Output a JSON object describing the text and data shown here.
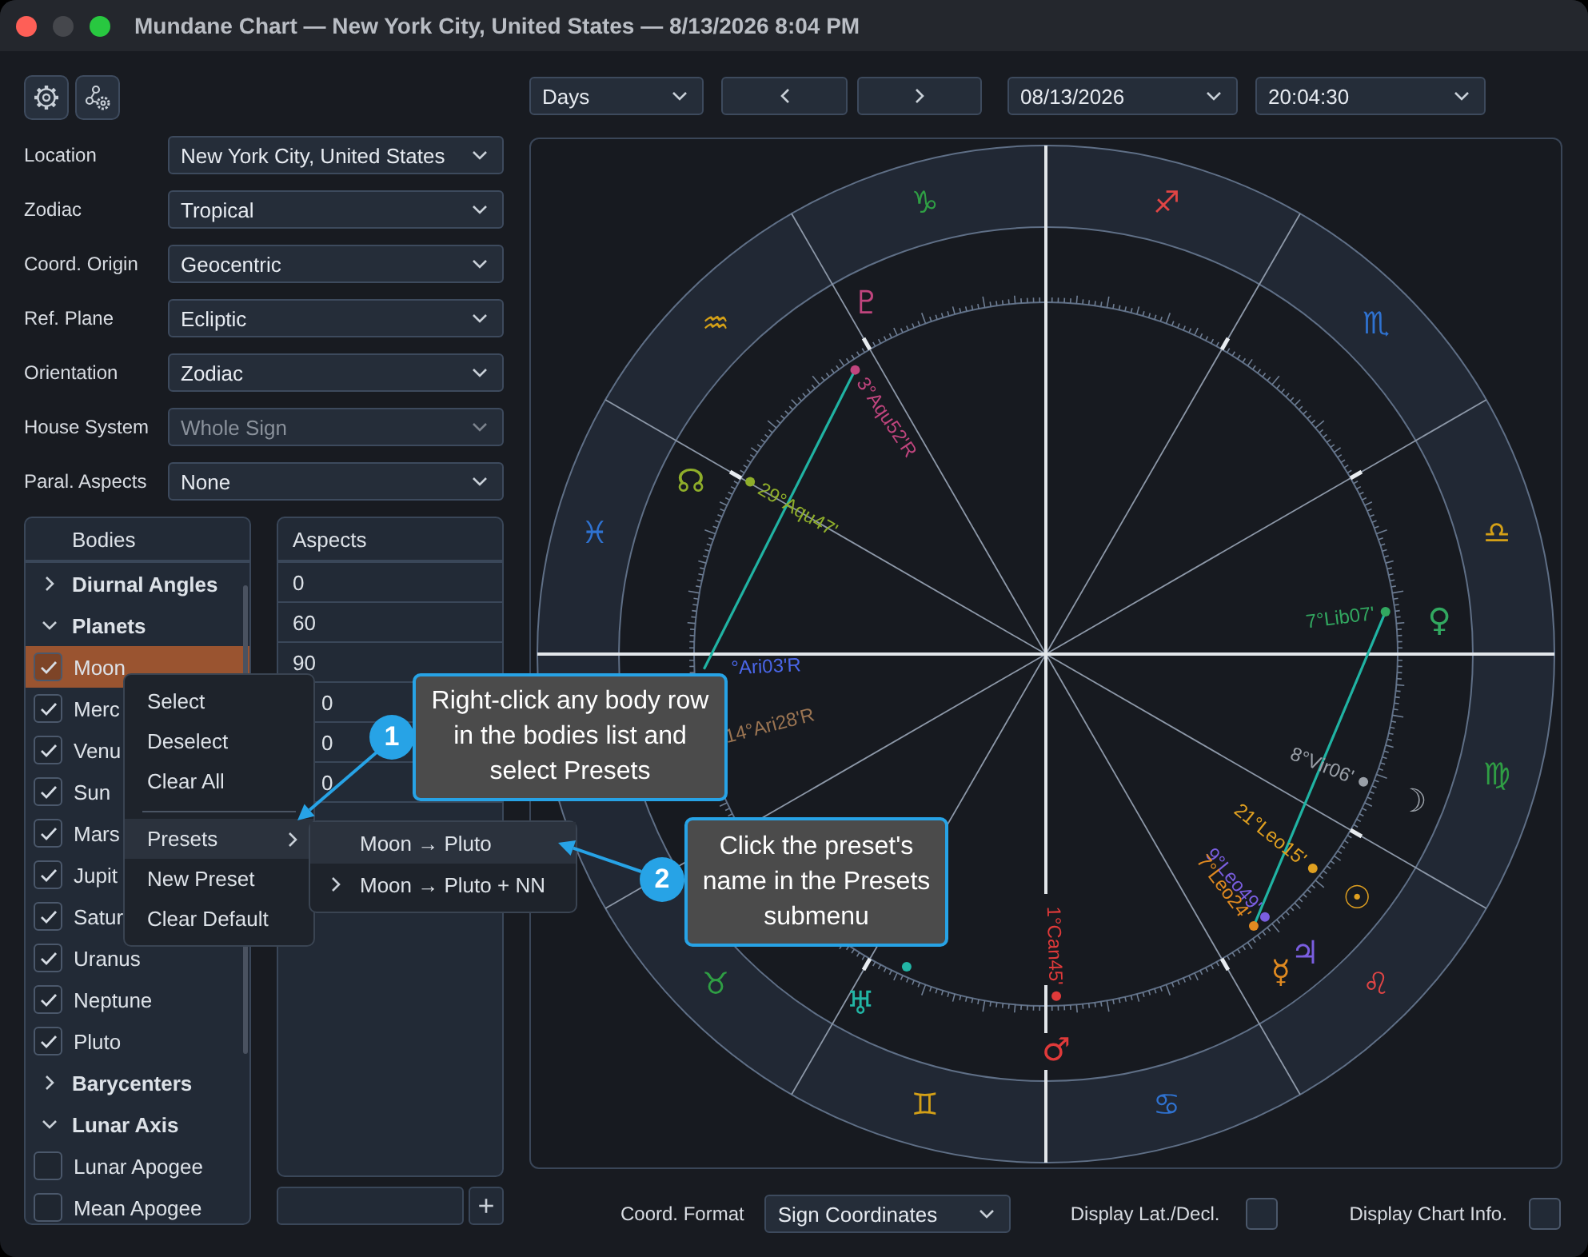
{
  "window": {
    "title": "Mundane Chart — New York City, United States — 8/13/2026 8:04 PM"
  },
  "settings": [
    {
      "label": "Location",
      "value": "New York City, United States",
      "disabled": false
    },
    {
      "label": "Zodiac",
      "value": "Tropical",
      "disabled": false
    },
    {
      "label": "Coord. Origin",
      "value": "Geocentric",
      "disabled": false
    },
    {
      "label": "Ref. Plane",
      "value": "Ecliptic",
      "disabled": false
    },
    {
      "label": "Orientation",
      "value": "Zodiac",
      "disabled": false
    },
    {
      "label": "House System",
      "value": "Whole Sign",
      "disabled": true
    },
    {
      "label": "Paral. Aspects",
      "value": "None",
      "disabled": false
    }
  ],
  "bodies": {
    "title": "Bodies",
    "items": [
      {
        "kind": "group",
        "label": "Diurnal Angles",
        "expanded": false
      },
      {
        "kind": "group",
        "label": "Planets",
        "expanded": true,
        "children": [
          {
            "kind": "body",
            "label": "Moon",
            "checked": true,
            "selected": true
          },
          {
            "kind": "body",
            "label": "Merc",
            "checked": true,
            "selected": false
          },
          {
            "kind": "body",
            "label": "Venu",
            "checked": true,
            "selected": false
          },
          {
            "kind": "body",
            "label": "Sun",
            "checked": true,
            "selected": false
          },
          {
            "kind": "body",
            "label": "Mars",
            "checked": true,
            "selected": false
          },
          {
            "kind": "body",
            "label": "Jupit",
            "checked": true,
            "selected": false
          },
          {
            "kind": "body",
            "label": "Satur",
            "checked": true,
            "selected": false
          },
          {
            "kind": "body",
            "label": "Uranus",
            "checked": true,
            "selected": false
          },
          {
            "kind": "body",
            "label": "Neptune",
            "checked": true,
            "selected": false
          },
          {
            "kind": "body",
            "label": "Pluto",
            "checked": true,
            "selected": false
          }
        ]
      },
      {
        "kind": "group",
        "label": "Barycenters",
        "expanded": false
      },
      {
        "kind": "group",
        "label": "Lunar Axis",
        "expanded": true,
        "children": [
          {
            "kind": "body",
            "label": "Lunar Apogee",
            "checked": false,
            "selected": false
          },
          {
            "kind": "body",
            "label": "Mean Apogee",
            "checked": false,
            "selected": false
          }
        ]
      }
    ]
  },
  "aspects": {
    "title": "Aspects",
    "rows": [
      {
        "value": "0"
      },
      {
        "value": "60"
      },
      {
        "value": "90"
      },
      {
        "value": "0",
        "clipped": true
      },
      {
        "value": "0",
        "clipped": true
      },
      {
        "value": "0",
        "clipped": true
      }
    ],
    "add_button": "+"
  },
  "toolbar": {
    "period": "Days",
    "date": "08/13/2026",
    "time": "20:04:30"
  },
  "chart": {
    "signs": [
      {
        "glyph": "♉",
        "color": "#2f9e44"
      },
      {
        "glyph": "♊",
        "color": "#d4a017"
      },
      {
        "glyph": "♋",
        "color": "#2f72d0"
      },
      {
        "glyph": "♌",
        "color": "#e04545"
      },
      {
        "glyph": "♍",
        "color": "#2f9e44"
      },
      {
        "glyph": "♎",
        "color": "#d4a017"
      },
      {
        "glyph": "♏",
        "color": "#2f72d0"
      },
      {
        "glyph": "♐",
        "color": "#e04545"
      },
      {
        "glyph": "♑",
        "color": "#2f9e44"
      },
      {
        "glyph": "♒",
        "color": "#d4a017"
      },
      {
        "glyph": "♓",
        "color": "#2f72d0"
      }
    ],
    "bodies": [
      {
        "glyph": "♇",
        "label": "3°Aqu52'R",
        "color": "#c0457e"
      },
      {
        "glyph": "☊",
        "label": "29°Aqu47'",
        "color": "#8fae2a"
      },
      {
        "glyph": "♀",
        "label": "7°Lib07'",
        "color": "#32a860"
      },
      {
        "glyph": "☽",
        "label": "8°Vir06'",
        "color": "#9aa0a8"
      },
      {
        "glyph": "☉",
        "label": "21°Leo15'",
        "color": "#e0a020"
      },
      {
        "glyph": "♃",
        "label": "9°Leo49'",
        "color": "#7a5ee0"
      },
      {
        "glyph": "☿",
        "label": "7°Leo24'",
        "color": "#e08a20"
      },
      {
        "glyph": "♂",
        "label": "1°Can45'",
        "color": "#e03a3a"
      },
      {
        "glyph": "♅",
        "color": "#22b5a5"
      },
      {
        "label": "°Ari03'R",
        "color": "#4a66e8"
      },
      {
        "label": "14°Ari28'R",
        "color": "#9a7452"
      }
    ]
  },
  "bottom_bar": {
    "coord_label": "Coord. Format",
    "coord_value": "Sign Coordinates",
    "latdecl_label": "Display Lat./Decl.",
    "latdecl_checked": false,
    "info_label": "Display Chart Info.",
    "info_checked": false
  },
  "context_menu": {
    "items": [
      {
        "kind": "item",
        "label": "Select",
        "selected": false
      },
      {
        "kind": "item",
        "label": "Deselect",
        "selected": false
      },
      {
        "kind": "item",
        "label": "Clear All",
        "selected": false
      },
      {
        "kind": "separator"
      },
      {
        "kind": "submenu",
        "label": "Presets",
        "selected": true
      },
      {
        "kind": "item",
        "label": "New Preset",
        "selected": false
      },
      {
        "kind": "item",
        "label": "Clear Default",
        "selected": false
      }
    ]
  },
  "submenu": {
    "items": [
      {
        "label": "Moon → Pluto",
        "selected": true,
        "has_children": false
      },
      {
        "label": "Moon → Pluto + NN",
        "selected": false,
        "has_children": true
      }
    ]
  },
  "callouts": [
    {
      "number": "1",
      "text": "Right-click any body row in the bodies list and select Presets"
    },
    {
      "number": "2",
      "text": "Click the preset's name in the Presets submenu"
    }
  ]
}
